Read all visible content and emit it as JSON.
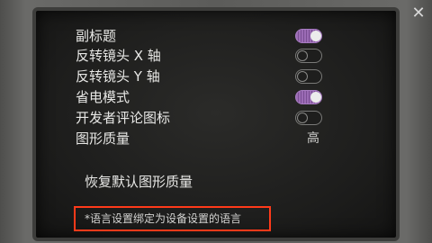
{
  "close_label": "✕",
  "settings": [
    {
      "label": "副标题",
      "control": "toggle",
      "state": "on"
    },
    {
      "label": "反转镜头 X 轴",
      "control": "toggle",
      "state": "off"
    },
    {
      "label": "反转镜头 Y 轴",
      "control": "toggle",
      "state": "off"
    },
    {
      "label": "省电模式",
      "control": "toggle",
      "state": "on"
    },
    {
      "label": "开发者评论图标",
      "control": "toggle",
      "state": "off"
    },
    {
      "label": "图形质量",
      "control": "value",
      "value": "高"
    }
  ],
  "reset_label": "恢复默认图形质量",
  "note": "*语言设置绑定为设备设置的语言",
  "colors": {
    "toggle_on": "#9b6bb5",
    "highlight_border": "#ff3a1a"
  }
}
